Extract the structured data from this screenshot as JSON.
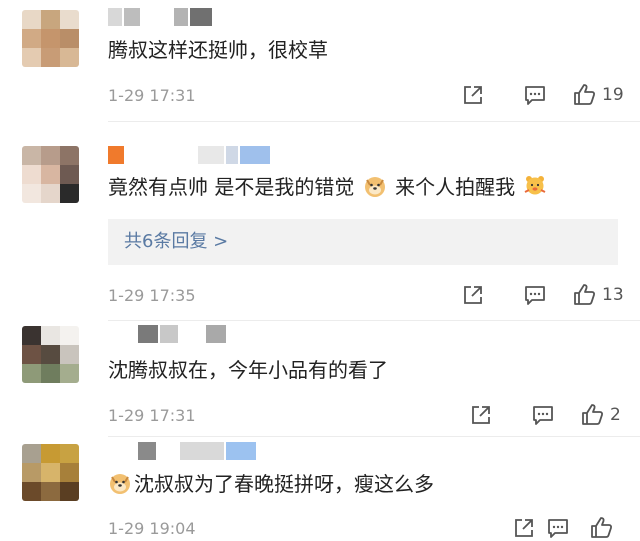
{
  "comments": [
    {
      "text": "腾叔这样还挺帅，很校草",
      "time": "1-29 17:31",
      "likes": "19"
    },
    {
      "text_a": "竟然有点帅 是不是我的错觉",
      "text_b": "来个人拍醒我",
      "replies_label": "共6条回复 >",
      "time": "1-29 17:35",
      "likes": "13"
    },
    {
      "text": "沈腾叔叔在，今年小品有的看了",
      "time": "1-29 17:31",
      "likes": "2"
    },
    {
      "text": "沈叔叔为了春晚挺拼呀，瘦这么多",
      "time": "1-29 19:04",
      "likes": ""
    }
  ],
  "icons": {
    "share": "share-icon",
    "comment": "comment-icon",
    "like": "thumbs-up-icon",
    "doge": "doge-emoji-icon",
    "bear": "bear-emoji-icon"
  },
  "colors": {
    "link": "#5a7aa3",
    "meta": "#9a9a9a",
    "reply_bg": "#f2f2f2"
  }
}
